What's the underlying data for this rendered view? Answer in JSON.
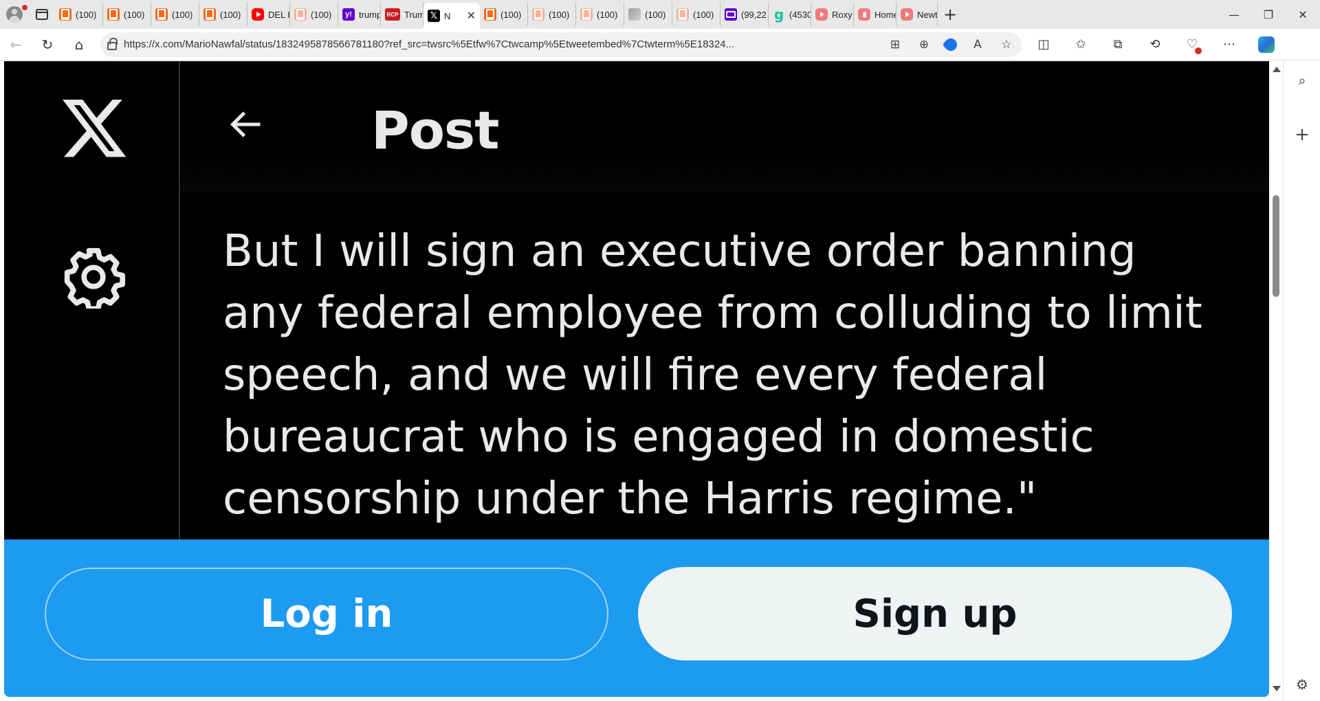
{
  "browser": {
    "tabs": [
      {
        "title": "(100)",
        "icon": "substack-icon",
        "variant": "orange"
      },
      {
        "title": "(100)",
        "icon": "substack-icon",
        "variant": "orange"
      },
      {
        "title": "(100)",
        "icon": "substack-icon",
        "variant": "orange"
      },
      {
        "title": "(100)",
        "icon": "substack-icon",
        "variant": "orange"
      },
      {
        "title": "DEL R",
        "icon": "youtube-icon",
        "variant": "red"
      },
      {
        "title": "(100)",
        "icon": "substack-icon",
        "variant": "peach"
      },
      {
        "title": "trump",
        "icon": "yahoo-icon",
        "variant": "yahoo",
        "glyph": "y!"
      },
      {
        "title": "Trump",
        "icon": "rcp-icon",
        "variant": "rcp",
        "glyph": "RCP"
      },
      {
        "title": "N",
        "icon": "x-icon",
        "variant": "x",
        "glyph": "𝕏",
        "active": true
      },
      {
        "title": "(100)",
        "icon": "substack-icon",
        "variant": "orange"
      },
      {
        "title": "(100)",
        "icon": "substack-icon",
        "variant": "peach"
      },
      {
        "title": "(100)",
        "icon": "substack-icon",
        "variant": "peach"
      },
      {
        "title": "(100)",
        "icon": "photo-icon",
        "variant": "photo"
      },
      {
        "title": "(100)",
        "icon": "substack-icon",
        "variant": "peach"
      },
      {
        "title": "(99,22",
        "icon": "yahoo-mail-icon",
        "variant": "mail"
      },
      {
        "title": "(4530",
        "icon": "grammarly-icon",
        "variant": "green",
        "glyph": "g"
      },
      {
        "title": "Roxy",
        "icon": "youtube-icon",
        "variant": "pinkred"
      },
      {
        "title": "Home",
        "icon": "podcast-icon",
        "variant": "mic"
      },
      {
        "title": "Newt",
        "icon": "youtube-icon",
        "variant": "pinkred"
      }
    ],
    "url": "https://x.com/MarioNawfal/status/1832495878566781180?ref_src=twsrc%5Etfw%7Ctwcamp%5Etweetembed%7Ctwterm%5E18324..."
  },
  "page": {
    "header_title": "Post",
    "tweet_text": "But I will sign an executive order banning any federal employee from colluding to limit speech, and we will fire every federal bureaucrat who is engaged in domestic censorship under the Harris regime.\"",
    "login_label": "Log in",
    "signup_label": "Sign up"
  },
  "colors": {
    "x_background": "#000000",
    "x_blue": "#1d9bf0",
    "text_primary": "#e7e9ea",
    "signup_bg": "#eff3f4"
  }
}
